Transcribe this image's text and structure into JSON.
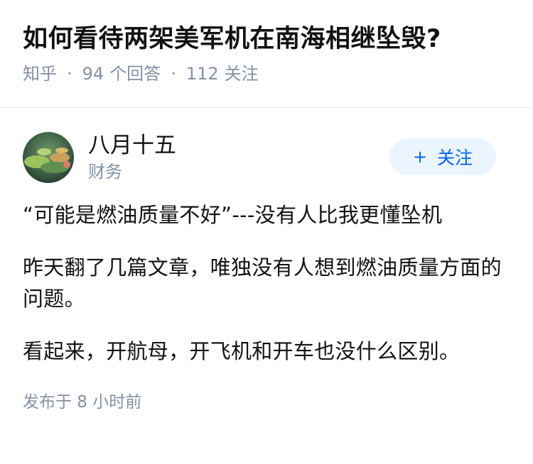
{
  "question": {
    "title": "如何看待两架美军机在南海相继坠毁?",
    "source": "知乎",
    "answer_count": "94",
    "answer_label": "个回答",
    "follow_count": "112",
    "follow_label": "关注"
  },
  "answer": {
    "author": {
      "name": "八月十五",
      "headline": "财务",
      "avatar_icon": "lotus-avatar-image"
    },
    "follow_button": {
      "icon": "+",
      "label": "关注"
    },
    "paragraphs": [
      "“可能是燃油质量不好”---没有人比我更懂坠机",
      "昨天翻了几篇文章，唯独没有人想到燃油质量方面的问题。",
      "看起来，开航母，开飞机和开车也没什么区别。"
    ],
    "post_time": "发布于  8 小时前"
  },
  "colors": {
    "meta_gray": "#8590a6",
    "follow_bg": "#ebf5ff",
    "follow_text": "#0066ff",
    "text": "#121212"
  }
}
